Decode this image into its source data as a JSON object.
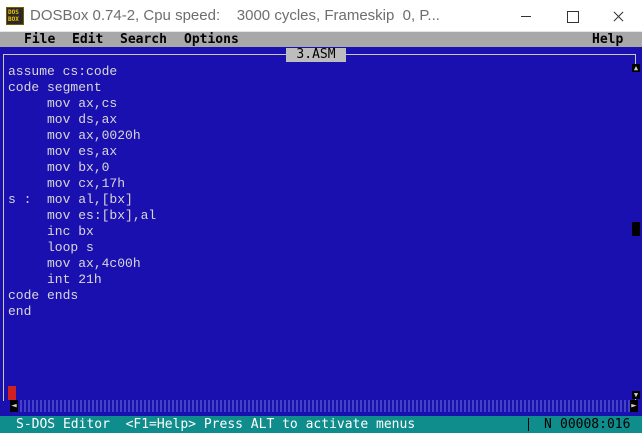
{
  "window": {
    "title": "DOSBox 0.74-2, Cpu speed:    3000 cycles, Frameskip  0, P...",
    "icon_line1": "DOS",
    "icon_line2": "BOX"
  },
  "menu": {
    "file": "File",
    "edit": "Edit",
    "search": "Search",
    "options": "Options",
    "help": "Help"
  },
  "editor": {
    "tab_title": "3.ASM",
    "lines": [
      "assume cs:code",
      "code segment",
      "     mov ax,cs",
      "     mov ds,ax",
      "     mov ax,0020h",
      "     mov es,ax",
      "     mov bx,0",
      "     mov cx,17h",
      "s :  mov al,[bx]",
      "     mov es:[bx],al",
      "     inc bx",
      "     loop s",
      "     mov ax,4c00h",
      "     int 21h",
      "code ends",
      "end"
    ]
  },
  "status": {
    "text": "S-DOS Editor  <F1=Help> Press ALT to activate menus",
    "indicator": "N",
    "position": "00008:016"
  },
  "icons": {
    "scroll_up": "scroll-up-arrow-icon",
    "scroll_down": "scroll-down-arrow-icon",
    "scroll_left": "scroll-left-arrow-icon",
    "scroll_right": "scroll-right-arrow-icon"
  },
  "colors": {
    "dos_background": "#1a10b0",
    "menu_background": "#a8a8a8",
    "status_background": "#0f8c8c",
    "text": "#d8d8d8"
  }
}
